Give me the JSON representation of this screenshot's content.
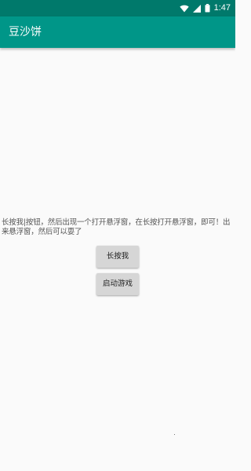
{
  "status_bar": {
    "time": "1:47",
    "icons": [
      "wifi-icon",
      "signal-icon",
      "battery-icon"
    ],
    "color": "#00796b"
  },
  "app_bar": {
    "title": "豆沙饼",
    "color": "#009688"
  },
  "main": {
    "instruction": "长按我|按钮，然后出现一个打开悬浮窗，在长按打开悬浮窗，即可！出来悬浮窗，然后可以耍了",
    "long_press_button": "长按我",
    "start_game_button": "启动游戏"
  }
}
